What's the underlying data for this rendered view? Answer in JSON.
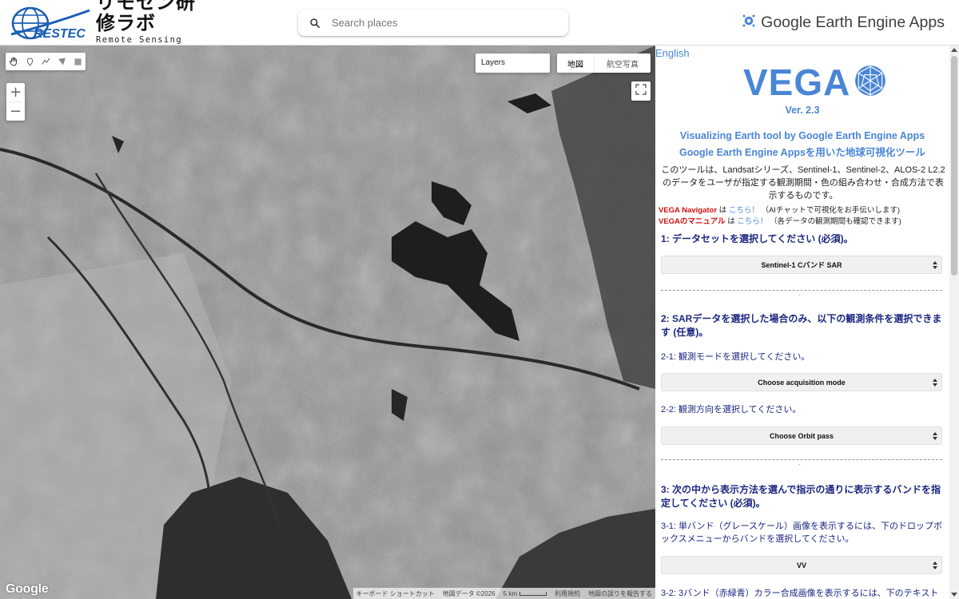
{
  "header": {
    "logo_emblem_text": "RESTEC",
    "logo_title_jp": "リモセン研修ラボ",
    "logo_title_en": "Remote Sensing Training Lab",
    "search_placeholder": "Search places",
    "brand_text": "Google Earth Engine Apps"
  },
  "map": {
    "layers_label": "Layers",
    "maptype_map": "地図",
    "maptype_satellite": "航空写真",
    "zoom_in": "+",
    "zoom_out": "−",
    "google_logo": "Google",
    "attribution": {
      "shortcuts": "キーボード ショートカット",
      "data": "地図データ ©2026",
      "scale": "5 km",
      "terms": "利用規約",
      "report": "地図の誤りを報告する"
    },
    "draw_tools": [
      "hand-icon",
      "marker-icon",
      "polyline-icon",
      "polygon-icon",
      "rectangle-icon"
    ]
  },
  "panel": {
    "lang_link": "English",
    "title": "VEGA",
    "version": "Ver. 2.3",
    "subtitle_en": "Visualizing Earth tool by Google Earth Engine Apps",
    "subtitle_jp": "Google Earth Engine Appsを用いた地球可視化ツール",
    "description": "このツールは、Landsatシリーズ、Sentinel-1、Sentinel-2、ALOS-2 L2.2のデータをユーザが指定する観測期間・色の組み合わせ・合成方法で表示するものです。",
    "note1": {
      "label": "VEGA Navigator",
      "mid": " は ",
      "link": "こちら！",
      "tail": " （AIチャットで可視化をお手伝いします)"
    },
    "note2": {
      "label": "VEGAのマニュアル",
      "mid": " は ",
      "link": "こちら！",
      "tail": " （各データの観測期間も確認できます)"
    },
    "section1_title": "1: データセットを選択してください (必須)。",
    "dataset_select": "Sentinel-1 Cバンド SAR",
    "section2_title": "2: SARデータを選択した場合のみ、以下の観測条件を選択できます (任意)。",
    "label_2_1": "2-1: 観測モードを選択してください。",
    "select_acq_mode": "Choose acquisition mode",
    "label_2_2": "2-2: 観測方向を選択してください。",
    "select_orbit": "Choose Orbit pass",
    "section3_title": "3: 次の中から表示方法を選んで指示の通りに表示するバンドを指定してください (必須)。",
    "label_3_1": "3-1: 単バンド（グレースケール）画像を表示するには、下のドロップボックスメニューからバンドを選択してください。",
    "select_band": "VV",
    "label_3_2": "3-2: 3バンド（赤緑青）カラー合成画像を表示するには、下のテキスト",
    "divider_mark": "-"
  },
  "colors": {
    "accent_blue": "#4a86d6",
    "section_navy": "#1c2680",
    "note_red": "#d01010",
    "restec_blue": "#1a5fb4"
  }
}
